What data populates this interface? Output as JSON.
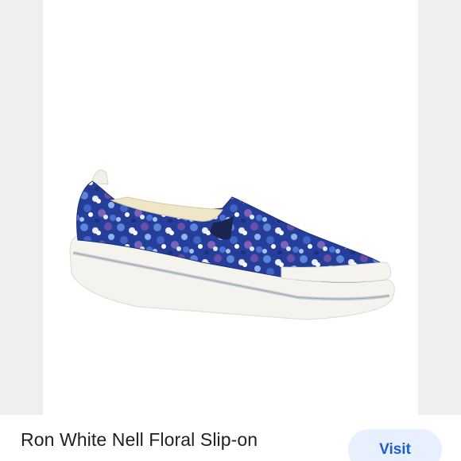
{
  "product": {
    "title": "Ron White Nell Floral Slip-on",
    "image_icon": "floral-slip-on-shoe"
  },
  "actions": {
    "visit_label": "Visit"
  },
  "colors": {
    "side_panel": "#eeeff1",
    "visit_bg": "#e8f0fe",
    "visit_text": "#1a5fd0",
    "title_text": "#202124"
  }
}
